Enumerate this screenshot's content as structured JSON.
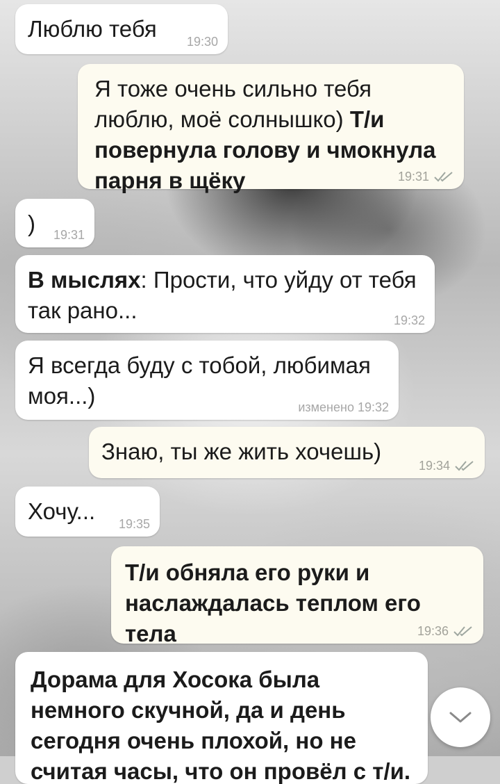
{
  "messages": [
    {
      "type": "in",
      "text": "Люблю тебя",
      "time": "19:30"
    },
    {
      "type": "out",
      "text_plain": "Я тоже очень сильно тебя люблю, моё солнышко) ",
      "text_bold": "Т/и повернула голову и чмокнула парня в щёку",
      "time": "19:31"
    },
    {
      "type": "in",
      "text": ")",
      "time": "19:31"
    },
    {
      "type": "in",
      "text_bold": "В мыслях",
      "text_plain": ": Прости, что уйду от тебя так рано...",
      "time": "19:32"
    },
    {
      "type": "in",
      "text": "Я всегда буду с тобой, любимая моя...)",
      "time": "изменено 19:32"
    },
    {
      "type": "out",
      "text": "Знаю, ты же жить хочешь)",
      "time": "19:34"
    },
    {
      "type": "in",
      "text": "Хочу...",
      "time": "19:35"
    },
    {
      "type": "out",
      "text_bold": "Т/и обняла его руки и наслаждалась теплом его тела",
      "time": "19:36"
    },
    {
      "type": "in",
      "text_bold": "Дорама для Хосока была немного скучной, да и день сегодня очень плохой, но не считая часы, что он провёл с т/и. Ведь она самое",
      "time": ""
    }
  ],
  "colors": {
    "incoming_bubble": "#ffffff",
    "outgoing_bubble": "#fdfbf0",
    "timestamp": "#a7a7a7",
    "read_check": "#9fa7a0"
  },
  "icons": {
    "read_status": "double-check-icon",
    "scroll_down": "chevron-down-icon"
  }
}
